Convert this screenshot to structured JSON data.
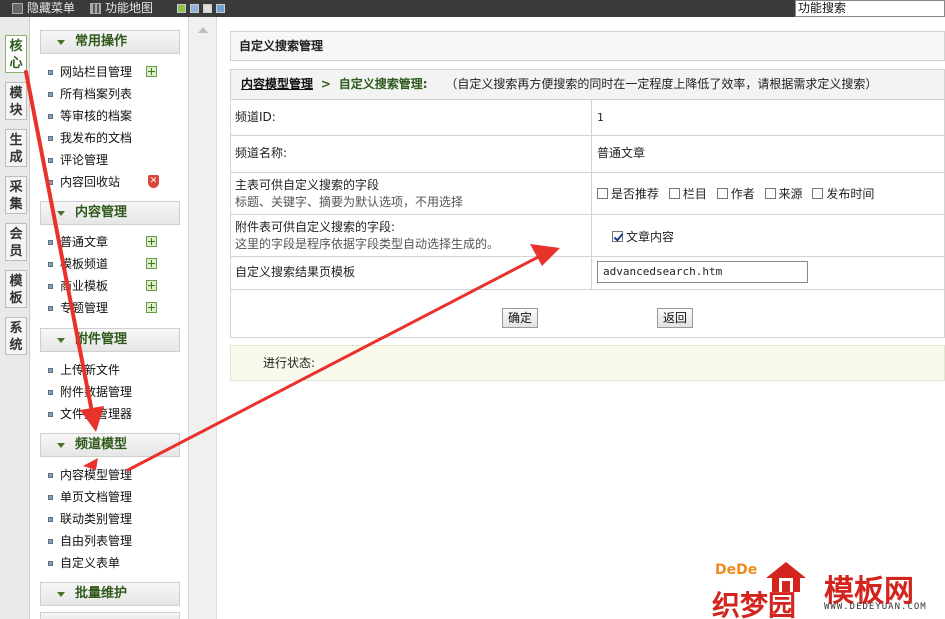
{
  "topbar": {
    "hide_menu": "隐藏菜单",
    "site_map": "功能地图",
    "search_placeholder": "功能搜索"
  },
  "vtabs": [
    {
      "label": "核心",
      "active": true
    },
    {
      "label": "模块"
    },
    {
      "label": "生成"
    },
    {
      "label": "采集"
    },
    {
      "label": "会员"
    },
    {
      "label": "模板"
    },
    {
      "label": "系统"
    }
  ],
  "sidebar": {
    "sections": [
      {
        "title": "常用操作",
        "items": [
          "网站栏目管理",
          "所有档案列表",
          "等审核的档案",
          "我发布的文档",
          "评论管理",
          "内容回收站"
        ]
      },
      {
        "title": "内容管理",
        "items": [
          "普通文章",
          "模板频道",
          "商业模板",
          "专题管理"
        ]
      },
      {
        "title": "附件管理",
        "items": [
          "上传新文件",
          "附件数据管理",
          "文件式管理器"
        ]
      },
      {
        "title": "频道模型",
        "items": [
          "内容模型管理",
          "单页文档管理",
          "联动类别管理",
          "自由列表管理",
          "自定义表单"
        ]
      },
      {
        "title": "批量维护",
        "items": []
      }
    ]
  },
  "main": {
    "title": "自定义搜索管理",
    "breadcrumb": {
      "link": "内容模型管理",
      "sep": ">",
      "current": "自定义搜索管理:",
      "note": "（自定义搜索再方便搜索的同时在一定程度上降低了效率，请根据需求定义搜索）"
    },
    "form": {
      "channel_id_label": "频道ID:",
      "channel_id_value": "1",
      "channel_name_label": "频道名称:",
      "channel_name_value": "普通文章",
      "main_fields_label": "主表可供自定义搜索的字段",
      "main_fields_hint": "标题、关键字、摘要为默认选项，不用选择",
      "main_fields_options": [
        {
          "label": "是否推荐",
          "checked": false
        },
        {
          "label": "栏目",
          "checked": false
        },
        {
          "label": "作者",
          "checked": false
        },
        {
          "label": "来源",
          "checked": false
        },
        {
          "label": "发布时间",
          "checked": false
        }
      ],
      "addon_fields_label": "附件表可供自定义搜索的字段:",
      "addon_fields_hint": "这里的字段是程序依据字段类型自动选择生成的。",
      "addon_fields_options": [
        {
          "label": "文章内容",
          "checked": true
        }
      ],
      "template_label": "自定义搜索结果页模板",
      "template_value": "advancedsearch.htm"
    },
    "buttons": {
      "confirm": "确定",
      "back": "返回"
    },
    "status_label": "进行状态:"
  },
  "watermark": {
    "brand_en": "DeDe",
    "brand_cn_left": "织梦园",
    "brand_cn_right": "模板网",
    "url": "WWW.DEDEYUAN.COM"
  },
  "colors": {
    "section_title": "#2f5a1c",
    "annotation_arrow": "#e8322b",
    "watermark_red": "#d4241e"
  }
}
